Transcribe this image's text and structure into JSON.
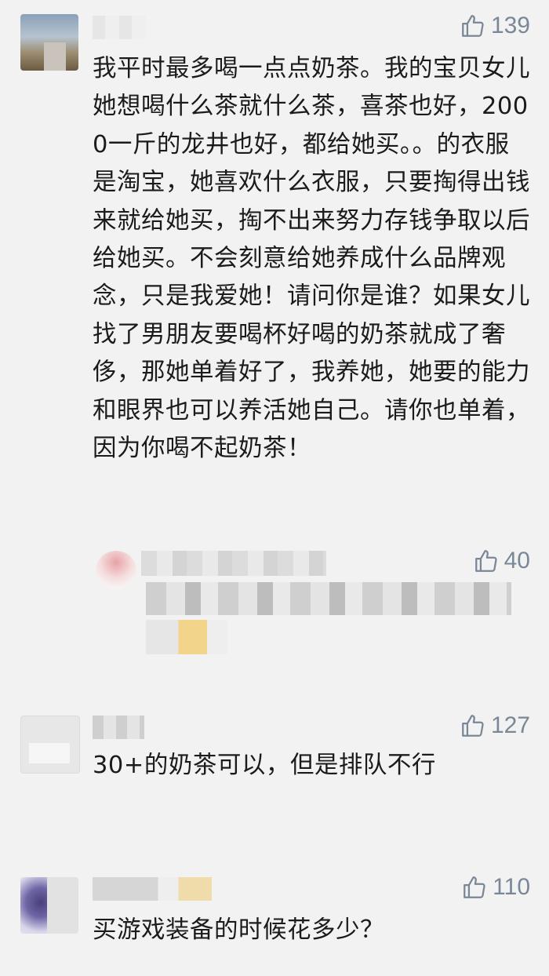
{
  "comments": [
    {
      "likes": "139",
      "text": "我平时最多喝一点点奶茶。我的宝贝女儿她想喝什么茶就什么茶，喜茶也好，2000一斤的龙井也好，都给她买。。的衣服是淘宝，她喜欢什么衣服，只要掏得出钱来就给她买，掏不出来努力存钱争取以后给她买。不会刻意给她养成什么品牌观念，只是我爱她！请问你是谁？如果女儿找了男朋友要喝杯好喝的奶茶就成了奢侈，那她单着好了，我养她，她要的能力和眼界也可以养活她自己。请你也单着，因为你喝不起奶茶！"
    },
    {
      "likes": "40"
    },
    {
      "likes": "127",
      "text": "30+的奶茶可以，但是排队不行"
    },
    {
      "likes": "110",
      "text": "买游戏装备的时候花多少？"
    }
  ],
  "icons": {
    "like": "thumbs-up-icon"
  },
  "colors": {
    "background": "#f2f2f2",
    "like": "#7a8796",
    "text": "#1b1b1b"
  }
}
